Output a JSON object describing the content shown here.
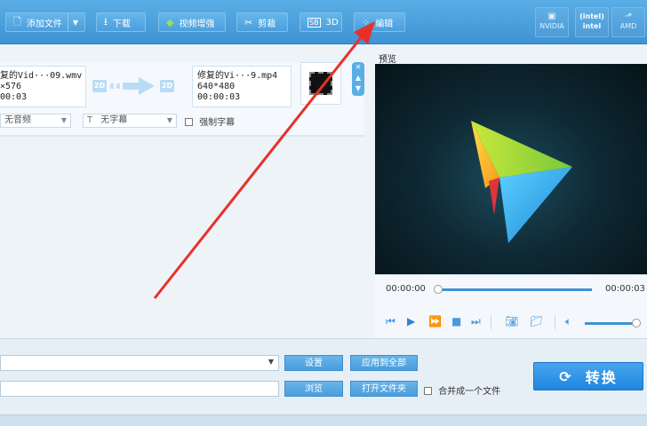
{
  "toolbar": {
    "add_file": "添加文件",
    "download": "下载",
    "enhance": "视频增强",
    "cut": "剪裁",
    "threed": "3D",
    "edit": "编辑",
    "nvidia": "NVIDIA",
    "intel": "intel",
    "amd": "AMD",
    "nvidia_icon": "nvidia-chip-icon",
    "intel_icon": "intel-logo-icon",
    "amd_icon": "amd-logo-icon"
  },
  "task": {
    "source_name": "复的Vid···09.wmv",
    "source_res": "×576",
    "source_duration": "00:03",
    "badge_2d": "2D",
    "target_name": "修复的Vi···9.mp4",
    "target_res": "640*480",
    "target_duration": "00:00:03",
    "audio_select": "无音频",
    "subtitle_select": "无字幕",
    "subtitle_icon": "T",
    "force_subtitle": "强制字幕"
  },
  "preview": {
    "label": "预览",
    "time_current": "00:00:00",
    "time_total": "00:00:03",
    "progress": 0,
    "volume": 1.0
  },
  "bottom": {
    "settings": "设置",
    "apply_all": "应用到全部",
    "browse": "浏览",
    "open_folder": "打开文件夹",
    "merge": "合并成一个文件",
    "convert": "转换"
  },
  "colors": {
    "accent": "#3f93d3",
    "annotation_arrow": "#e8302a"
  }
}
